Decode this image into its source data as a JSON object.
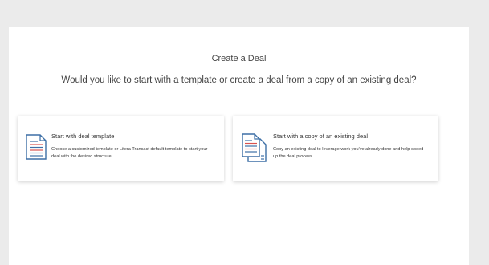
{
  "page": {
    "title": "Create a Deal",
    "question": "Would you like to start with a template or create a deal from a copy of an existing deal?"
  },
  "cards": [
    {
      "title": "Start with deal template",
      "description": "Choose a customized template or Litera Transact default template to start your deal with the desired structure.",
      "icon": "document-template-icon"
    },
    {
      "title": "Start with a copy of an existing deal",
      "description": "Copy an existing deal to leverage work you've already done and help speed up the deal process.",
      "icon": "copy-documents-icon"
    }
  ],
  "colors": {
    "background": "#ebebeb",
    "panel": "#ffffff",
    "icon_blue": "#3d6fa6",
    "icon_red": "#d9534f"
  }
}
